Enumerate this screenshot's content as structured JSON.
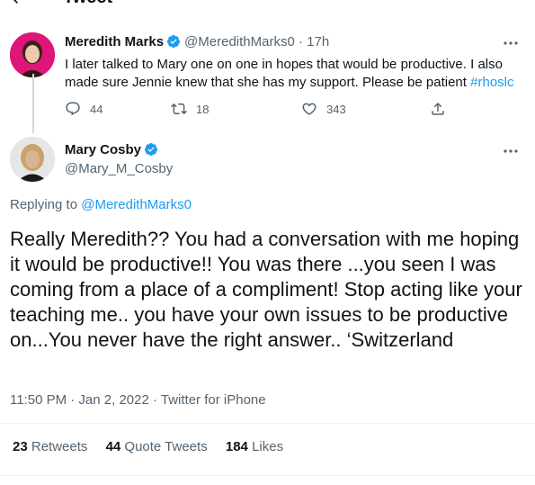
{
  "header": {
    "title": "Tweet"
  },
  "parent_tweet": {
    "author_name": "Meredith Marks",
    "handle": "@MeredithMarks0",
    "separator": "·",
    "time": "17h",
    "text_main": "I later talked to Mary one on one in hopes that would be productive. I also made sure Jennie knew that she has my support. Please be patient ",
    "hashtag": "#rhoslc",
    "replies": "44",
    "retweets": "18",
    "likes": "343"
  },
  "main_tweet": {
    "author_name": "Mary Cosby",
    "handle": "@Mary_M_Cosby",
    "replying_label": "Replying to ",
    "replying_handle": "@MeredithMarks0",
    "text": "Really Meredith?? You had a conversation with me hoping it would be productive!! You was there ...you seen I was coming from a place of a compliment! Stop acting like your teaching me.. you have your own issues to be productive on...You never have the right answer.. ‘Switzerland",
    "timestamp": "11:50 PM · Jan 2, 2022 · Twitter for iPhone",
    "stats": {
      "retweets_count": "23",
      "retweets_label": " Retweets",
      "quote_count": "44",
      "quote_label": " Quote Tweets",
      "likes_count": "184",
      "likes_label": " Likes"
    }
  },
  "colors": {
    "accent": "#1d9bf0",
    "text": "#0f1419",
    "secondary": "#536471",
    "avatar1_bg": "#e0157a"
  },
  "icons": [
    "back-arrow-icon",
    "verified-badge-icon",
    "more-options-icon",
    "reply-icon",
    "retweet-icon",
    "like-icon",
    "share-icon"
  ]
}
